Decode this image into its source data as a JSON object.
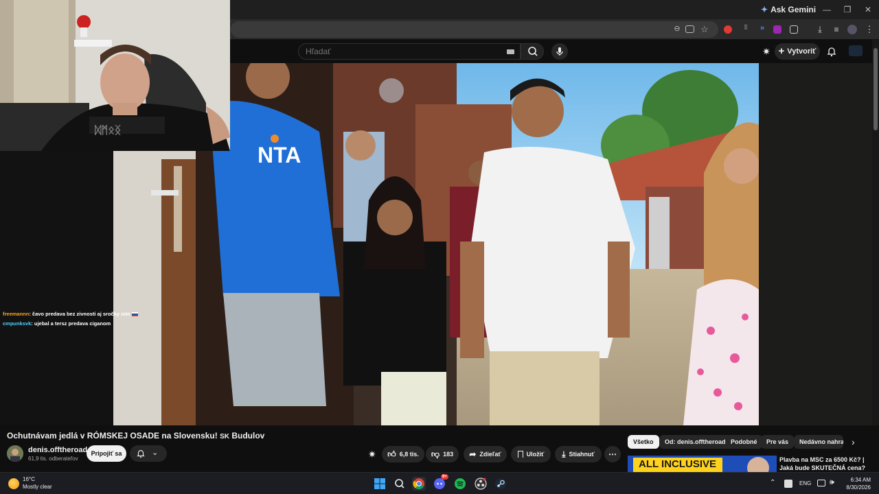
{
  "browser": {
    "ask_gemini": "Ask Gemini"
  },
  "youtube": {
    "search_placeholder": "Hľadať",
    "create_label": "Vytvoriť"
  },
  "stream_chat": [
    {
      "user": "freemannn",
      "user_color": "#f5a623",
      "message": ": čavo predava bez zivnosti aj sročky isto"
    },
    {
      "user": "cmpunksvk",
      "user_color": "#4fd1ff",
      "message": ": ujebal a tersz predava ciganom"
    }
  ],
  "video": {
    "title": "Ochutnávam jedlá v RÓMSKEJ OSADE na Slovensku! ",
    "title_flag": "SK",
    "title_suffix": " Budulov",
    "channel_name": "denis.offtheroad",
    "subscribers": "61,9 tis. odberateľov",
    "join_label": "Pripojiť sa",
    "likes": "6,8 tis.",
    "dislikes": "183",
    "share_label": "Zdieľať",
    "save_label": "Uložiť",
    "download_label": "Stiahnuť",
    "shirt_text": "NTA"
  },
  "chips": [
    "Všetko",
    "Od: denis.offtheroad",
    "Podobné",
    "Pre vás",
    "Nedávno nahrané"
  ],
  "recommendation": {
    "thumb_text": "ALL INCLUSIVE",
    "title": "Plavba na MSC za 6500 Kč? | Jaká bude SKUTEČNÁ cena? |"
  },
  "taskbar": {
    "temperature": "16°C",
    "weather": "Mostly clear",
    "language": "ENG",
    "time": "6:34 AM",
    "date": "8/30/2026",
    "discord_badge": "9+"
  },
  "colors": {
    "background": "#0f0f0f",
    "chip_active": "#f1f1f1",
    "taskbar": "#1c1d22"
  }
}
